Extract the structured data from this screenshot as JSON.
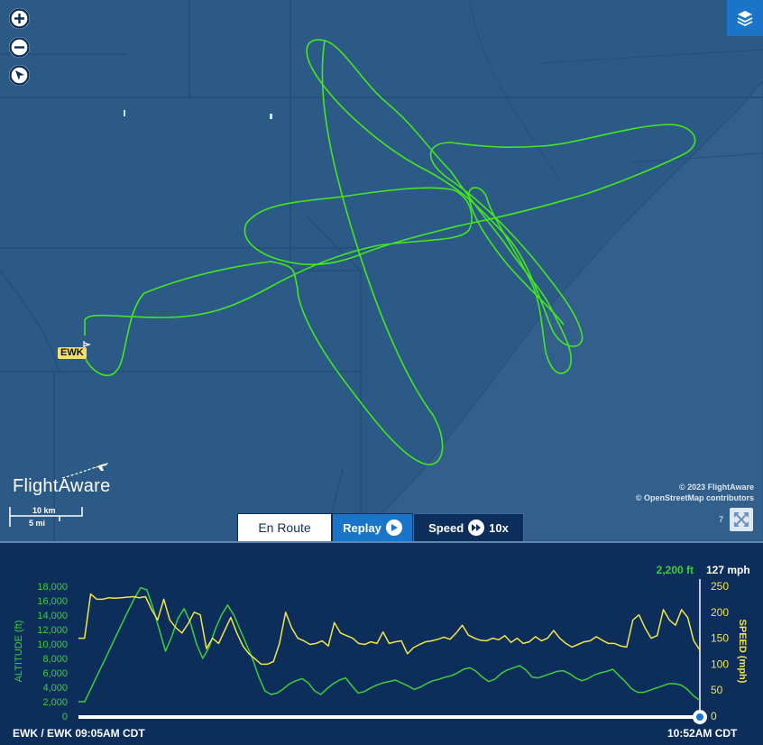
{
  "map": {
    "airport_label": "EWK",
    "logo_text": "FlightAware",
    "scale": {
      "km_label": "10 km",
      "mi_label": "5 mi"
    },
    "copyright_line1": "© 2023 FlightAware",
    "copyright_line2": "© OpenStreetMap contributors",
    "small_number": "7",
    "controls": [
      "zoom-in",
      "zoom-out",
      "compass"
    ],
    "colors": {
      "water": "#2c5a86",
      "track": "#44e620",
      "label_bg": "#f4e06a"
    }
  },
  "tabs": {
    "en_route": "En Route",
    "replay": "Replay",
    "speed": "Speed",
    "speed_value": "10x"
  },
  "chart": {
    "current_altitude": "2,200 ft",
    "current_speed": "127 mph",
    "left_axis_label": "ALTITUDE (ft)",
    "right_axis_label": "SPEED (mph)",
    "start_label": "EWK / EWK 09:05AM CDT",
    "end_label": "10:52AM CDT",
    "colors": {
      "altitude": "#3dcf3d",
      "speed": "#f0e64a",
      "background": "#0d2d5a"
    }
  },
  "chart_data": {
    "type": "line",
    "x_range": [
      "09:05AM CDT",
      "10:52AM CDT"
    ],
    "y_left": {
      "label": "ALTITUDE (ft)",
      "range": [
        0,
        18000
      ],
      "ticks": [
        "0",
        "2,000",
        "4,000",
        "6,000",
        "8,000",
        "10,000",
        "12,000",
        "14,000",
        "16,000",
        "18,000"
      ]
    },
    "y_right": {
      "label": "SPEED (mph)",
      "range": [
        0,
        250
      ],
      "ticks": [
        "0",
        "50",
        "100",
        "150",
        "200",
        "250"
      ]
    },
    "series": [
      {
        "name": "ALTITUDE (ft)",
        "values": [
          2000,
          2000,
          3800,
          5600,
          7400,
          9200,
          11000,
          12800,
          14600,
          16300,
          17800,
          17500,
          15000,
          12000,
          9000,
          11000,
          13500,
          14900,
          13000,
          10000,
          8000,
          9500,
          12000,
          14000,
          15400,
          14000,
          12000,
          10000,
          8000,
          5500,
          3500,
          3000,
          3200,
          3800,
          4500,
          4900,
          5200,
          4600,
          3500,
          3000,
          3800,
          4500,
          5000,
          5300,
          4200,
          3200,
          3400,
          3900,
          4300,
          4600,
          4800,
          5000,
          4600,
          4200,
          3700,
          4000,
          4500,
          4900,
          5100,
          5400,
          5600,
          6000,
          6500,
          6700,
          6200,
          5400,
          4800,
          5100,
          5900,
          6400,
          6700,
          7000,
          6400,
          5400,
          5300,
          5600,
          5900,
          6200,
          6300,
          5900,
          5300,
          4900,
          5200,
          5700,
          6000,
          6200,
          6500,
          5600,
          4800,
          3800,
          3300,
          3300,
          3600,
          3900,
          4200,
          4500,
          4500,
          4300,
          3700,
          2800,
          2200
        ],
        "y_axis": "left"
      },
      {
        "name": "SPEED (mph)",
        "values": [
          150,
          150,
          235,
          225,
          225,
          228,
          227,
          228,
          229,
          230,
          228,
          230,
          205,
          185,
          225,
          185,
          170,
          160,
          178,
          200,
          195,
          130,
          150,
          140,
          165,
          190,
          160,
          135,
          120,
          110,
          100,
          100,
          105,
          140,
          200,
          170,
          150,
          145,
          138,
          140,
          145,
          135,
          180,
          160,
          155,
          150,
          140,
          138,
          143,
          140,
          162,
          140,
          143,
          145,
          120,
          132,
          138,
          143,
          145,
          148,
          152,
          148,
          160,
          175,
          156,
          150,
          146,
          145,
          150,
          147,
          155,
          142,
          150,
          140,
          143,
          153,
          145,
          150,
          165,
          150,
          140,
          133,
          138,
          143,
          145,
          153,
          146,
          140,
          140,
          135,
          133,
          185,
          195,
          170,
          150,
          155,
          205,
          185,
          175,
          205,
          190,
          145,
          127
        ],
        "y_axis": "right"
      }
    ]
  }
}
